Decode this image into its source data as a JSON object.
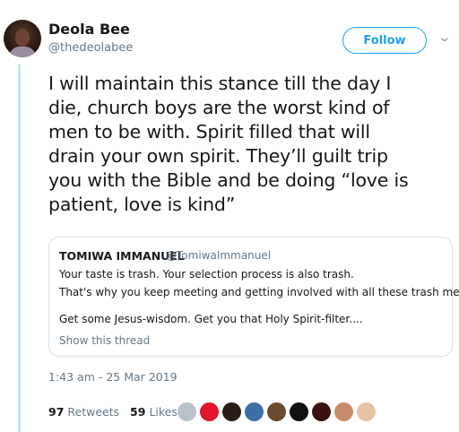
{
  "author": {
    "display_name": "Deola Bee",
    "handle": "@thedeolabee"
  },
  "follow_button": {
    "label": "Follow"
  },
  "tweet": {
    "lines": [
      "I will maintain this stance till the day I",
      "die, church boys are the worst kind of",
      "men to be with. Spirit filled that will",
      "drain your own spirit. They’ll guilt trip",
      "you with the Bible and be doing “love is",
      "patient, love is kind”"
    ]
  },
  "quoted_tweet": {
    "name": "TOMIWA IMMANUEL",
    "handle": "@TomiwaImmanuel",
    "lines": [
      "Your taste is trash. Your selection process is also trash.",
      "That's why you keep meeting and getting involved with all these trash men.",
      "",
      "Get some Jesus-wisdom. Get you that Holy Spirit-filter...."
    ],
    "show_thread": "Show this thread"
  },
  "timestamp": "1:43 am - 25 Mar 2019",
  "stats": {
    "retweets_count": "97",
    "retweets_label": "Retweets",
    "likes_count": "59",
    "likes_label": "Likes"
  },
  "colors": {
    "accent": "#1da1f2",
    "thread_line": "#c2e5f5",
    "secondary_text": "#657786"
  },
  "likers": [
    {
      "icon": "default-avatar",
      "color": "#b8c2c9"
    },
    {
      "icon": "red-avatar",
      "color": "#e0162b"
    },
    {
      "icon": "dark-avatar",
      "color": "#2a1d17"
    },
    {
      "icon": "blue-avatar",
      "color": "#3d6ea8"
    },
    {
      "icon": "sunglasses-avatar",
      "color": "#6b4a2e"
    },
    {
      "icon": "anonymous-mask-avatar",
      "color": "#111111"
    },
    {
      "icon": "text-logo-avatar",
      "color": "#3a1010"
    },
    {
      "icon": "person-avatar",
      "color": "#c98a6a"
    },
    {
      "icon": "person-avatar",
      "color": "#e6c2a4"
    }
  ]
}
